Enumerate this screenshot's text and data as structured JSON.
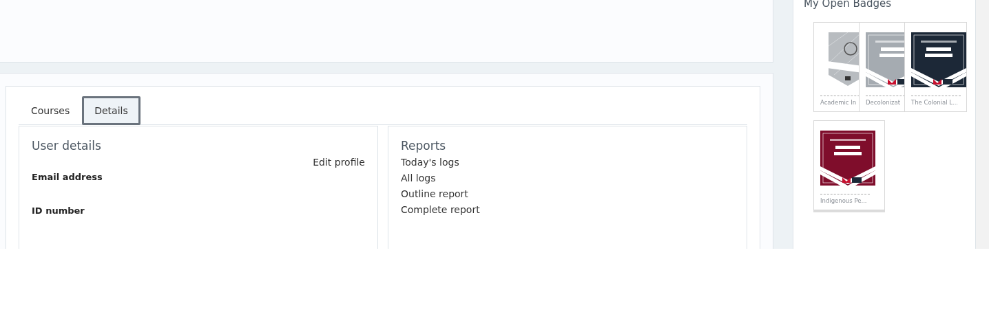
{
  "tabs": [
    {
      "label": "Courses",
      "selected": false
    },
    {
      "label": "Details",
      "selected": true
    }
  ],
  "user_details": {
    "title": "User details",
    "edit_link": "Edit profile",
    "fields": [
      {
        "label": "Email address"
      },
      {
        "label": "ID number"
      }
    ]
  },
  "reports": {
    "title": "Reports",
    "links": [
      "Today's logs",
      "All logs",
      "Outline report",
      "Complete report"
    ]
  },
  "badges": {
    "title": "My Open Badges",
    "items": [
      {
        "kind": "pattern",
        "label": "Academic In"
      },
      {
        "kind": "grey",
        "label": "Decolonizat"
      },
      {
        "kind": "navy",
        "label": "The Colonial L..."
      },
      {
        "kind": "maroon",
        "label": "Indigenous Pe..."
      }
    ]
  }
}
